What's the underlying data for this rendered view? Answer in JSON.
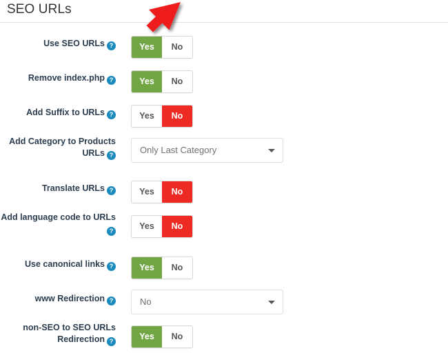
{
  "panel": {
    "title": "SEO URLs"
  },
  "icons": {
    "help": "?",
    "help_name": "help-icon",
    "caret": "chevron-down-icon",
    "arrow": "red-pointer-arrow"
  },
  "colors": {
    "toggle_yes_active": "#72a544",
    "toggle_no_active": "#ee2a24",
    "help_icon": "#1b8bbd",
    "label_text": "#2b3d4f",
    "annotation_arrow": "#ee1c1c",
    "divider": "#e2e2e2"
  },
  "toggle_options": {
    "yes": "Yes",
    "no": "No"
  },
  "rows": [
    {
      "label": "Use SEO URLs",
      "type": "toggle",
      "value": "Yes",
      "name": "use-seo-urls"
    },
    {
      "label": "Remove index.php",
      "type": "toggle",
      "value": "Yes",
      "name": "remove-index-php"
    },
    {
      "label": "Add Suffix to URLs",
      "type": "toggle",
      "value": "No",
      "name": "add-suffix-to-urls"
    },
    {
      "label": "Add Category to Products URLs",
      "type": "select",
      "value": "Only Last Category",
      "name": "add-category-to-products-urls"
    },
    {
      "label": "Translate URLs",
      "type": "toggle",
      "value": "No",
      "name": "translate-urls"
    },
    {
      "label": "Add language code to URLs",
      "type": "toggle",
      "value": "No",
      "name": "add-language-code-to-urls"
    },
    {
      "label": "Use canonical links",
      "type": "toggle",
      "value": "Yes",
      "name": "use-canonical-links"
    },
    {
      "label": "www Redirection",
      "type": "select",
      "value": "No",
      "name": "www-redirection"
    },
    {
      "label": "non-SEO to SEO URLs Redirection",
      "type": "toggle",
      "value": "Yes",
      "name": "non-seo-to-seo-urls-redirection"
    }
  ]
}
